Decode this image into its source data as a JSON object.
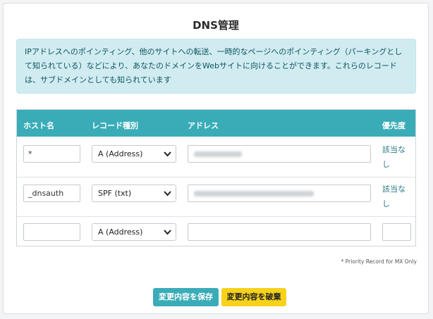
{
  "page": {
    "title": "DNS管理"
  },
  "info": {
    "text": "IPアドレスへのポインティング、他のサイトへの転送、一時的なページへのポインティング（パーキングとして知られている）などにより、あなたのドメインをWebサイトに向けることができます。これらのレコードは、サブドメインとしても知られています"
  },
  "table": {
    "headers": {
      "host": "ホスト名",
      "record_type": "レコード種別",
      "address": "アドレス",
      "priority": "優先度"
    },
    "rows": [
      {
        "host": "*",
        "record_type": "A (Address)",
        "address_redacted": true,
        "priority": "該当なし"
      },
      {
        "host": "_dnsauth",
        "record_type": "SPF (txt)",
        "address_redacted": true,
        "priority": "該当なし"
      },
      {
        "host": "",
        "record_type": "A (Address)",
        "address": "",
        "priority": ""
      }
    ]
  },
  "note": "* Priority Record for MX Only",
  "buttons": {
    "save": "変更内容を保存",
    "discard": "変更内容を破棄"
  },
  "icons": {
    "select_arrow": "chevron-down-icon"
  },
  "colors": {
    "accent": "#3aacb8",
    "info_bg": "#d1ecf1",
    "discard": "#f6d21c"
  }
}
